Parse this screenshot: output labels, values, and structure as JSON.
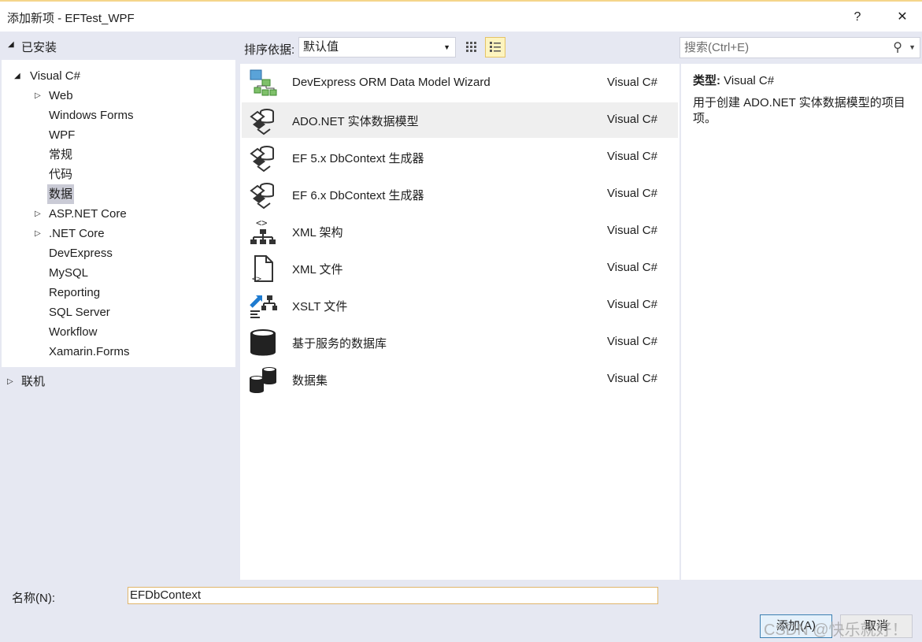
{
  "window": {
    "title": "添加新项 - EFTest_WPF",
    "help_label": "?",
    "close_label": "✕"
  },
  "tree": {
    "installed_label": "已安装",
    "root_label": "Visual C#",
    "items": [
      {
        "label": "Web",
        "expandable": true
      },
      {
        "label": "Windows Forms",
        "expandable": false
      },
      {
        "label": "WPF",
        "expandable": false
      },
      {
        "label": "常规",
        "expandable": false
      },
      {
        "label": "代码",
        "expandable": false
      },
      {
        "label": "数据",
        "expandable": false,
        "selected": true
      },
      {
        "label": "ASP.NET Core",
        "expandable": true
      },
      {
        "label": ".NET Core",
        "expandable": true
      },
      {
        "label": "DevExpress",
        "expandable": false
      },
      {
        "label": "MySQL",
        "expandable": false
      },
      {
        "label": "Reporting",
        "expandable": false
      },
      {
        "label": "SQL Server",
        "expandable": false
      },
      {
        "label": "Workflow",
        "expandable": false
      },
      {
        "label": "Xamarin.Forms",
        "expandable": false
      }
    ],
    "online_label": "联机"
  },
  "toolbar": {
    "sort_label": "排序依据:",
    "sort_value": "默认值",
    "search_placeholder": "搜索(Ctrl+E)"
  },
  "templates": [
    {
      "name": "DevExpress ORM Data Model Wizard",
      "type": "Visual C#",
      "icon": "orm-wizard-icon"
    },
    {
      "name": "ADO.NET 实体数据模型",
      "type": "Visual C#",
      "icon": "entity-model-icon",
      "selected": true
    },
    {
      "name": "EF 5.x DbContext 生成器",
      "type": "Visual C#",
      "icon": "dbcontext-generator-icon"
    },
    {
      "name": "EF 6.x DbContext 生成器",
      "type": "Visual C#",
      "icon": "dbcontext-generator-icon"
    },
    {
      "name": "XML 架构",
      "type": "Visual C#",
      "icon": "xml-schema-icon"
    },
    {
      "name": "XML 文件",
      "type": "Visual C#",
      "icon": "xml-file-icon"
    },
    {
      "name": "XSLT 文件",
      "type": "Visual C#",
      "icon": "xslt-file-icon"
    },
    {
      "name": "基于服务的数据库",
      "type": "Visual C#",
      "icon": "database-icon"
    },
    {
      "name": "数据集",
      "type": "Visual C#",
      "icon": "dataset-icon"
    }
  ],
  "details": {
    "type_label": "类型:",
    "type_value": "Visual C#",
    "description": "用于创建 ADO.NET 实体数据模型的项目项。"
  },
  "footer": {
    "name_label": "名称(N):",
    "name_value": "EFDbContext",
    "add_label": "添加(A)",
    "cancel_label": "取消",
    "watermark": "CSDN @快乐就好！"
  }
}
